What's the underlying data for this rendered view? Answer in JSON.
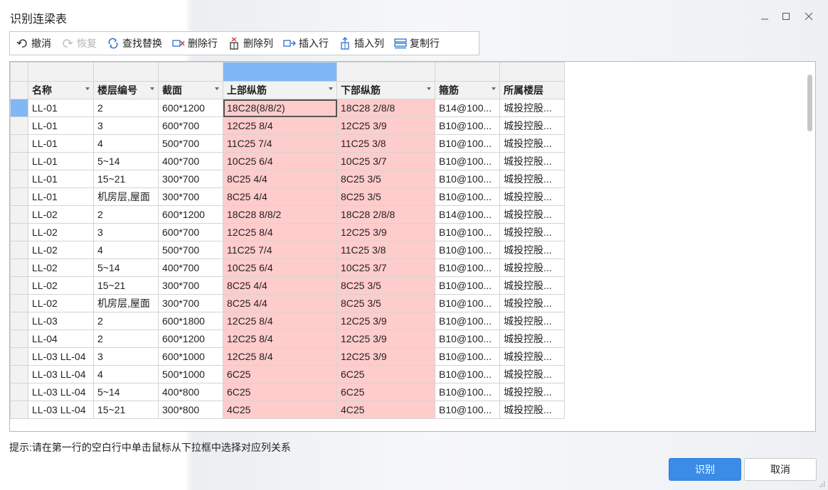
{
  "window": {
    "title": "识别连梁表"
  },
  "toolbar": [
    {
      "label": "撤消",
      "icon": "undo-icon",
      "disabled": false
    },
    {
      "label": "恢复",
      "icon": "redo-icon",
      "disabled": true
    },
    {
      "label": "查找替换",
      "icon": "find-replace-icon",
      "disabled": false
    },
    {
      "label": "删除行",
      "icon": "delete-row-icon",
      "disabled": false
    },
    {
      "label": "删除列",
      "icon": "delete-column-icon",
      "disabled": false
    },
    {
      "label": "插入行",
      "icon": "insert-row-icon",
      "disabled": false
    },
    {
      "label": "插入列",
      "icon": "insert-column-icon",
      "disabled": false
    },
    {
      "label": "复制行",
      "icon": "copy-row-icon",
      "disabled": false
    }
  ],
  "grid": {
    "headers": [
      "名称",
      "楼层编号",
      "截面",
      "上部纵筋",
      "下部纵筋",
      "箍筋",
      "所属楼层"
    ],
    "rows": [
      [
        "LL-01",
        "2",
        "600*1200",
        "18C28(8/8/2)",
        "18C28 2/8/8",
        "B14@100...",
        "城投控股..."
      ],
      [
        "LL-01",
        "3",
        "600*700",
        "12C25 8/4",
        "12C25 3/9",
        "B10@100...",
        "城投控股..."
      ],
      [
        "LL-01",
        "4",
        "500*700",
        "11C25 7/4",
        "11C25 3/8",
        "B10@100...",
        "城投控股..."
      ],
      [
        "LL-01",
        "5~14",
        "400*700",
        "10C25 6/4",
        "10C25 3/7",
        "B10@100...",
        "城投控股..."
      ],
      [
        "LL-01",
        "15~21",
        "300*700",
        "8C25 4/4",
        "8C25 3/5",
        "B10@100...",
        "城投控股..."
      ],
      [
        "LL-01",
        "机房层,屋面",
        "300*700",
        "8C25 4/4",
        "8C25 3/5",
        "B10@100...",
        "城投控股..."
      ],
      [
        "LL-02",
        "2",
        "600*1200",
        "18C28 8/8/2",
        "18C28 2/8/8",
        "B14@100...",
        "城投控股..."
      ],
      [
        "LL-02",
        "3",
        "600*700",
        "12C25 8/4",
        "12C25 3/9",
        "B10@100...",
        "城投控股..."
      ],
      [
        "LL-02",
        "4",
        "500*700",
        "11C25 7/4",
        "11C25 3/8",
        "B10@100...",
        "城投控股..."
      ],
      [
        "LL-02",
        "5~14",
        "400*700",
        "10C25 6/4",
        "10C25 3/7",
        "B10@100...",
        "城投控股..."
      ],
      [
        "LL-02",
        "15~21",
        "300*700",
        "8C25 4/4",
        "8C25 3/5",
        "B10@100...",
        "城投控股..."
      ],
      [
        "LL-02",
        "机房层,屋面",
        "300*700",
        "8C25 4/4",
        "8C25 3/5",
        "B10@100...",
        "城投控股..."
      ],
      [
        "LL-03",
        "2",
        "600*1800",
        "12C25 8/4",
        "12C25 3/9",
        "B10@100...",
        "城投控股..."
      ],
      [
        "LL-04",
        "2",
        "600*1200",
        "12C25 8/4",
        "12C25 3/9",
        "B10@100...",
        "城投控股..."
      ],
      [
        "LL-03 LL-04",
        "3",
        "600*1000",
        "12C25 8/4",
        "12C25 3/9",
        "B10@100...",
        "城投控股..."
      ],
      [
        "LL-03 LL-04",
        "4",
        "500*1000",
        "6C25",
        "6C25",
        "B10@100...",
        "城投控股..."
      ],
      [
        "LL-03 LL-04",
        "5~14",
        "400*800",
        "6C25",
        "6C25",
        "B10@100...",
        "城投控股..."
      ],
      [
        "LL-03 LL-04",
        "15~21",
        "300*800",
        "4C25",
        "4C25",
        "B10@100...",
        "城投控股..."
      ]
    ]
  },
  "hint": "提示:请在第一行的空白行中单击鼠标从下拉框中选择对应列关系",
  "buttons": {
    "ok": "识别",
    "cancel": "取消"
  },
  "colors": {
    "selected": "#7fb8f5",
    "highlight": "#ffcccc",
    "primary": "#3b8ce6"
  }
}
